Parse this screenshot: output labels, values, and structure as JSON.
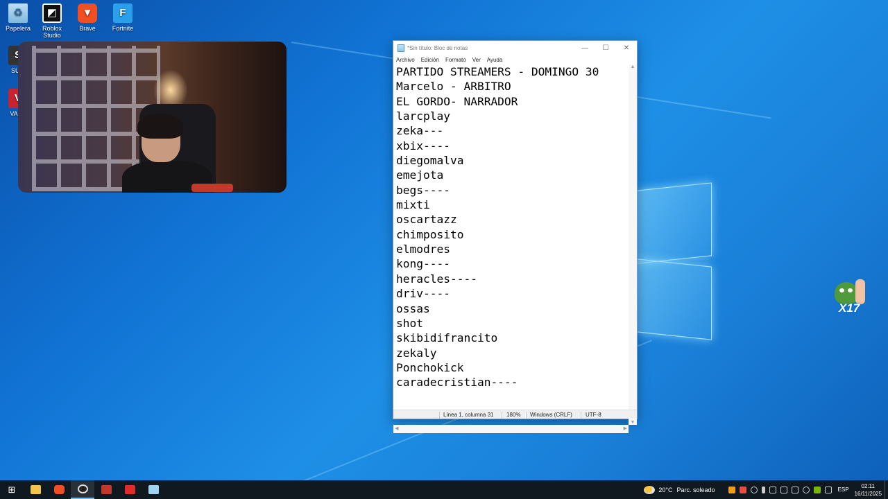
{
  "desktop": {
    "icons": [
      {
        "label": "Papelera",
        "icon": "recycle-bin-icon"
      },
      {
        "label": "Roblox\nStudio",
        "icon": "roblox-studio-icon"
      },
      {
        "label": "Brave",
        "icon": "brave-browser-icon"
      },
      {
        "label": "Fortnite",
        "icon": "fortnite-icon"
      },
      {
        "label": "SUM",
        "icon": "sumo-app-icon"
      },
      {
        "label": "VALO",
        "icon": "valorant-icon"
      }
    ],
    "emote_text": "X17"
  },
  "notepad": {
    "title": "*Sin título: Bloc de notas",
    "menu": [
      "Archivo",
      "Edición",
      "Formato",
      "Ver",
      "Ayuda"
    ],
    "window_buttons": {
      "minimize": "—",
      "maximize": "☐",
      "close": "✕"
    },
    "lines": [
      "PARTIDO STREAMERS - DOMINGO 30",
      "Marcelo - ARBITRO",
      "EL GORDO- NARRADOR",
      "larcplay",
      "zeka---",
      "xbix----",
      "diegomalva",
      "emejota",
      "begs----",
      "mixti",
      "oscartazz",
      "chimposito",
      "elmodres",
      "kong----",
      "heracles----",
      "driv----",
      "ossas",
      "shot",
      "skibidifrancito",
      "zekaly",
      "Ponchokick",
      "caradecristian----"
    ],
    "status": {
      "position": "Línea 1, columna 31",
      "zoom": "180%",
      "line_ending": "Windows (CRLF)",
      "encoding": "UTF-8"
    }
  },
  "taskbar": {
    "weather": {
      "temp": "20°C",
      "desc": "Parc. soleado"
    },
    "language": "ESP",
    "time": "02:11",
    "date": "16/11/2025"
  },
  "colors": {
    "desktop_bg": "#1173d4",
    "taskbar_bg": "#101820",
    "window_border": "#7a9fd2"
  }
}
